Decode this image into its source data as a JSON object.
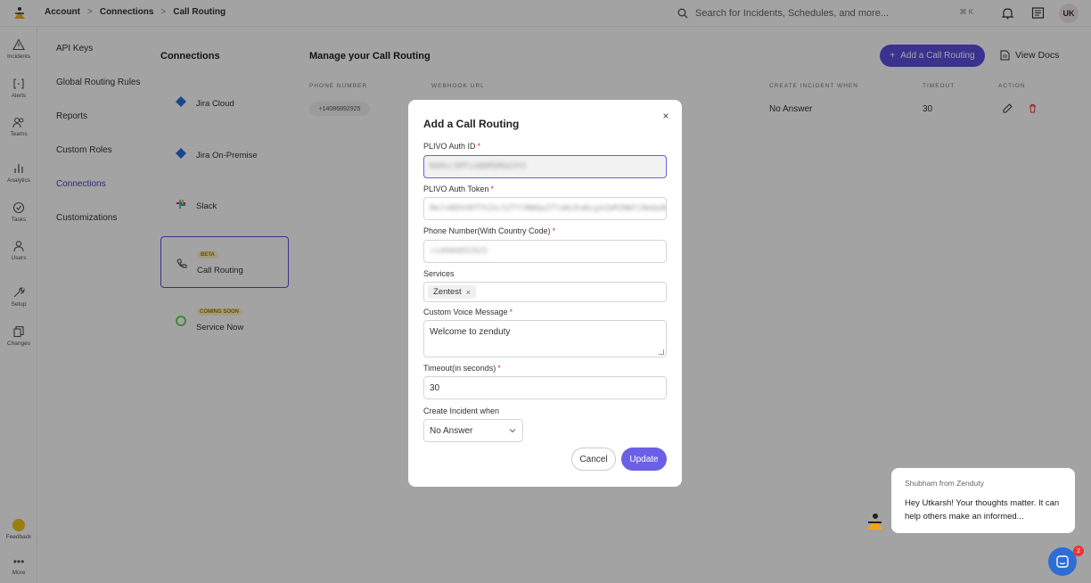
{
  "breadcrumb": [
    "Account",
    "Connections",
    "Call Routing"
  ],
  "breadcrumb_sep": ">",
  "search": {
    "placeholder": "Search for Incidents, Schedules, and more...",
    "shortcut": "⌘ K"
  },
  "user": {
    "initials": "UK"
  },
  "rail": [
    {
      "label": "Incidents",
      "icon": "warning-icon"
    },
    {
      "label": "Alerts",
      "icon": "alert-brackets-icon"
    },
    {
      "label": "Teams",
      "icon": "users-icon"
    },
    {
      "label": "Analytics",
      "icon": "bar-chart-icon"
    },
    {
      "label": "Tasks",
      "icon": "clock-check-icon"
    },
    {
      "label": "Users",
      "icon": "user-icon"
    },
    {
      "label": "Setup",
      "icon": "wrench-icon"
    },
    {
      "label": "Changes",
      "icon": "copy-icon"
    }
  ],
  "feedback": {
    "label": "Feedback",
    "more": "More"
  },
  "settings_nav": [
    "API Keys",
    "Global Routing Rules",
    "Reports",
    "Custom Roles",
    "Connections",
    "Customizations"
  ],
  "connections": {
    "title": "Connections",
    "items": [
      {
        "name": "Jira Cloud",
        "badge": ""
      },
      {
        "name": "Jira On-Premise",
        "badge": ""
      },
      {
        "name": "Slack",
        "badge": ""
      },
      {
        "name": "Call Routing",
        "badge": "BETA"
      },
      {
        "name": "Service Now",
        "badge": "COMING SOON"
      }
    ]
  },
  "main": {
    "title": "Manage your Call Routing",
    "add_button": "Add a Call Routing",
    "view_docs": "View Docs",
    "columns": [
      "PHONE NUMBER",
      "WEBHOOK URL",
      "CREATE INCIDENT WHEN",
      "TIMEOUT",
      "ACTION"
    ],
    "row": {
      "phone": "+14086892925",
      "create_when": "No Answer",
      "timeout": "30"
    }
  },
  "modal": {
    "title": "Add a Call Routing",
    "auth_id_label": "PLIVO Auth ID",
    "auth_id_value": "MAMzc5MTs1NDM5MGU3Y5",
    "auth_token_label": "PLIVO Auth Token",
    "auth_token_value": "MmJsNDhhNTFkZGc5ZTY3NWQwZTlmNzEwNzg4ZmM3NWYzNmQwNzEzbg",
    "phone_label": "Phone Number(With Country Code)",
    "phone_value": "+14086892925",
    "services_label": "Services",
    "services_tag": "Zentest",
    "voice_label": "Custom Voice Message",
    "voice_value": "Welcome to zenduty",
    "timeout_label": "Timeout(in seconds)",
    "timeout_value": "30",
    "create_label": "Create Incident when",
    "create_value": "No Answer",
    "cancel": "Cancel",
    "update": "Update",
    "required_mark": "*"
  },
  "chat": {
    "from": "Shubham from Zenduty",
    "message": "Hey Utkarsh!  Your thoughts matter. It can help others make an informed...",
    "unread": "2"
  },
  "colors": {
    "accent": "#5b4fe0",
    "update": "#6a5fe6",
    "launcher": "#2f6dd5"
  }
}
